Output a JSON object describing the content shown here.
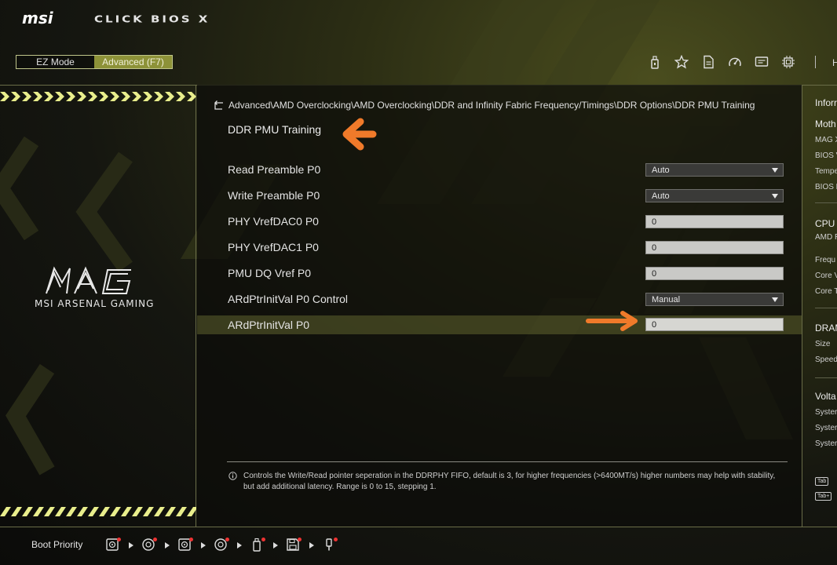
{
  "header": {
    "bios_title": "CLICK BIOS X",
    "logo_text": "msi",
    "mode_ez": "EZ Mode",
    "mode_advanced": "Advanced (F7)",
    "icons": [
      "usb-icon",
      "favorite-star-icon",
      "document-icon",
      "gauge-icon",
      "monitor-icon",
      "cpu-chip-icon"
    ],
    "partial_text": "H"
  },
  "left_panel": {
    "logo_text": "MAG",
    "brand": "MSI ARSENAL GAMING"
  },
  "main": {
    "breadcrumb": "Advanced\\AMD Overclocking\\AMD Overclocking\\DDR and Infinity Fabric Frequency/Timings\\DDR Options\\DDR PMU Training",
    "title": "DDR PMU Training",
    "settings": [
      {
        "label": "Read Preamble P0",
        "type": "select",
        "value": "Auto"
      },
      {
        "label": "Write Preamble P0",
        "type": "select",
        "value": "Auto"
      },
      {
        "label": "PHY VrefDAC0 P0",
        "type": "input",
        "value": "0"
      },
      {
        "label": "PHY VrefDAC1 P0",
        "type": "input",
        "value": "0"
      },
      {
        "label": "PMU DQ Vref P0",
        "type": "input",
        "value": "0"
      },
      {
        "label": "ARdPtrInitVal P0 Control",
        "type": "select",
        "value": "Manual"
      },
      {
        "label": "ARdPtrInitVal P0",
        "type": "input",
        "value": "0",
        "selected": true
      }
    ],
    "help_text": "Controls the Write/Read pointer seperation in the DDRPHY FIFO, default is 3, for higher frequencies (>6400MT/s) higher numbers may help with stability, but add additional latency. Range is 0 to 15, stepping 1."
  },
  "right_panel": {
    "info_title": "Inforr",
    "mb_title": "Moth",
    "mb_items": [
      "MAG X",
      "BIOS V",
      "Tempe",
      "BIOS D"
    ],
    "cpu_title": "CPU",
    "cpu_name": "AMD R",
    "cpu_items": [
      "Frequ",
      "Core V",
      "Core T"
    ],
    "dram_title": "DRAM",
    "dram_items": [
      "Size",
      "Speed"
    ],
    "volt_title": "Volta",
    "volt_items": [
      "Syster",
      "Syster",
      "Syster"
    ],
    "keys": [
      "Tab",
      "Tab+"
    ]
  },
  "boot": {
    "label": "Boot Priority",
    "devices": [
      "hdd-icon",
      "optical-disc-icon",
      "hdd-icon",
      "optical-disc-icon",
      "usb-drive-icon",
      "floppy-icon",
      "usb-key-icon"
    ]
  },
  "colors": {
    "accent": "#8d9238",
    "annotation_arrow": "#f07a2a",
    "selected_row": "#55582a",
    "stripe_yellow": "#e9ee8c"
  }
}
